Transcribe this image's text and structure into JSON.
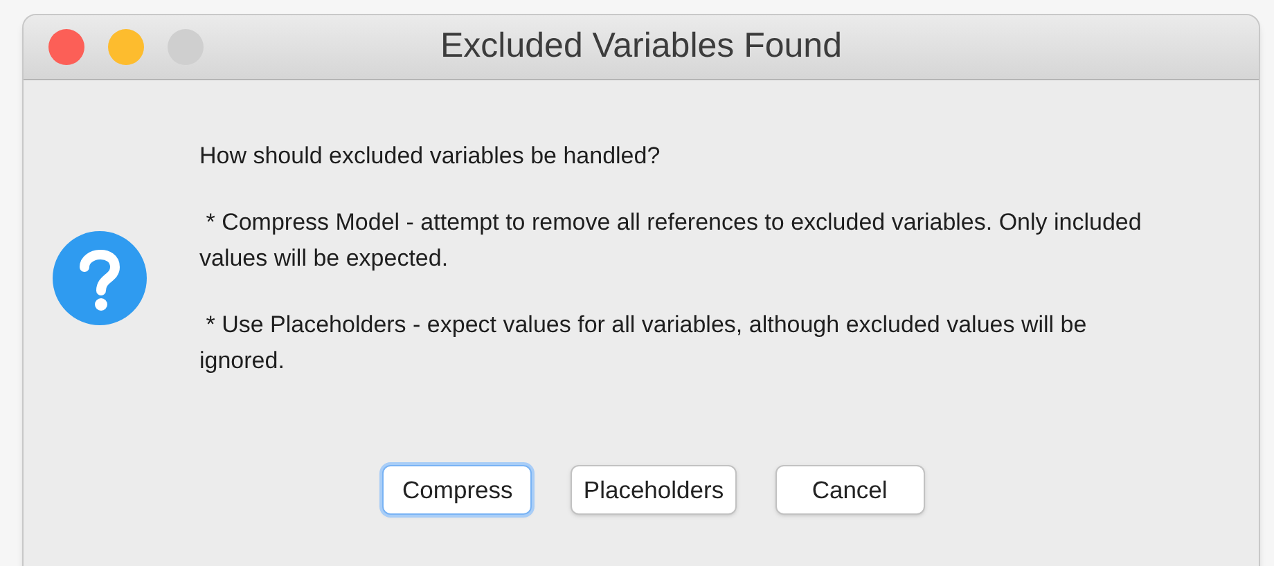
{
  "window": {
    "title": "Excluded Variables Found",
    "controls": [
      {
        "color": "#fc5f57"
      },
      {
        "color": "#fdbc2e"
      },
      {
        "color": "#cfcfcf"
      }
    ]
  },
  "message": {
    "question": "How should excluded variables be handled?",
    "options": [
      " * Compress Model - attempt to remove all references to excluded variables. Only included values will be expected.",
      " * Use Placeholders - expect values for all variables, although excluded values will be ignored."
    ]
  },
  "buttons": [
    {
      "label": "Compress",
      "focused": true
    },
    {
      "label": "Placeholders",
      "focused": false
    },
    {
      "label": "Cancel",
      "focused": false
    }
  ]
}
